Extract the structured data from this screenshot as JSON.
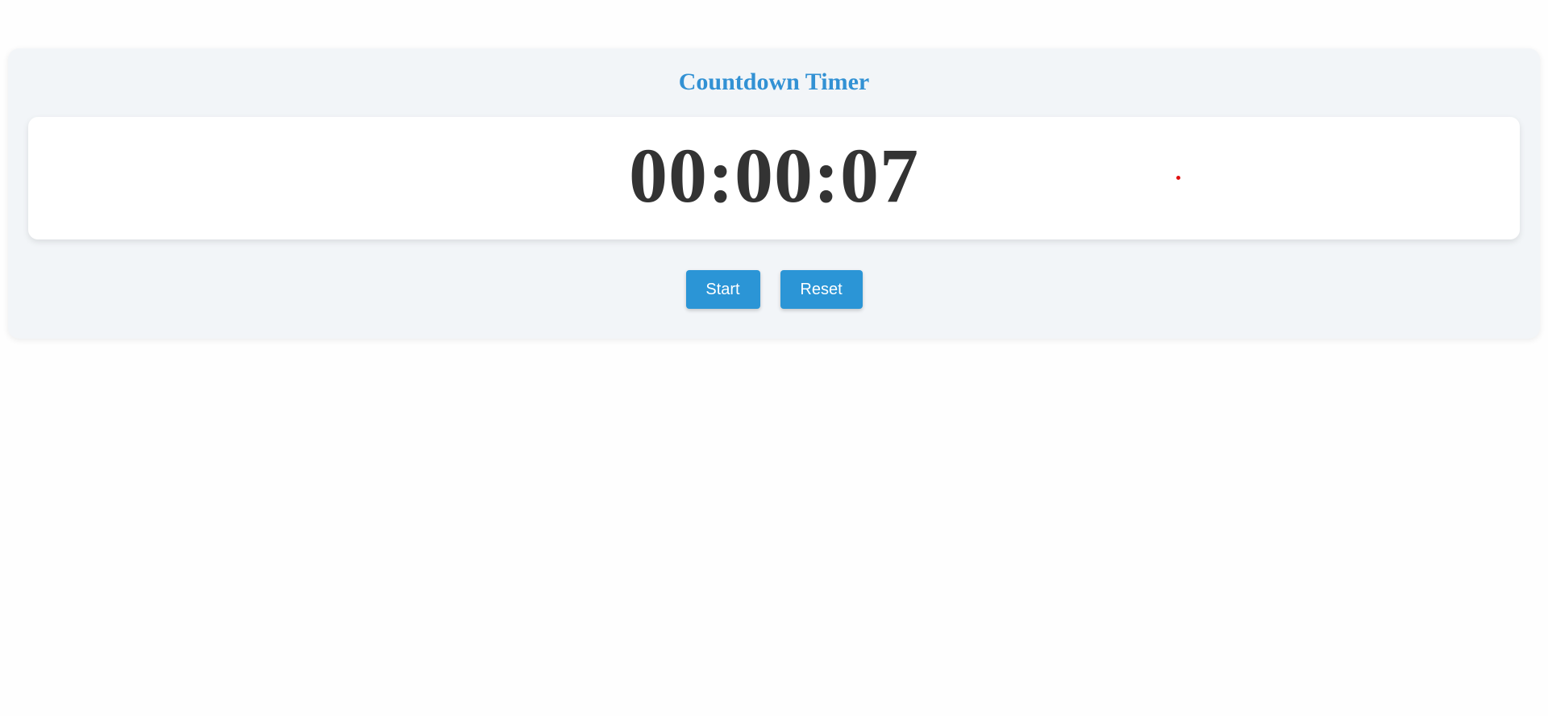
{
  "timer": {
    "title": "Countdown Timer",
    "time": "00:00:07",
    "start_label": "Start",
    "reset_label": "Reset"
  },
  "colors": {
    "accent": "#3291d4",
    "button": "#2b95d6",
    "indicator": "#e01010",
    "text": "#333333"
  }
}
